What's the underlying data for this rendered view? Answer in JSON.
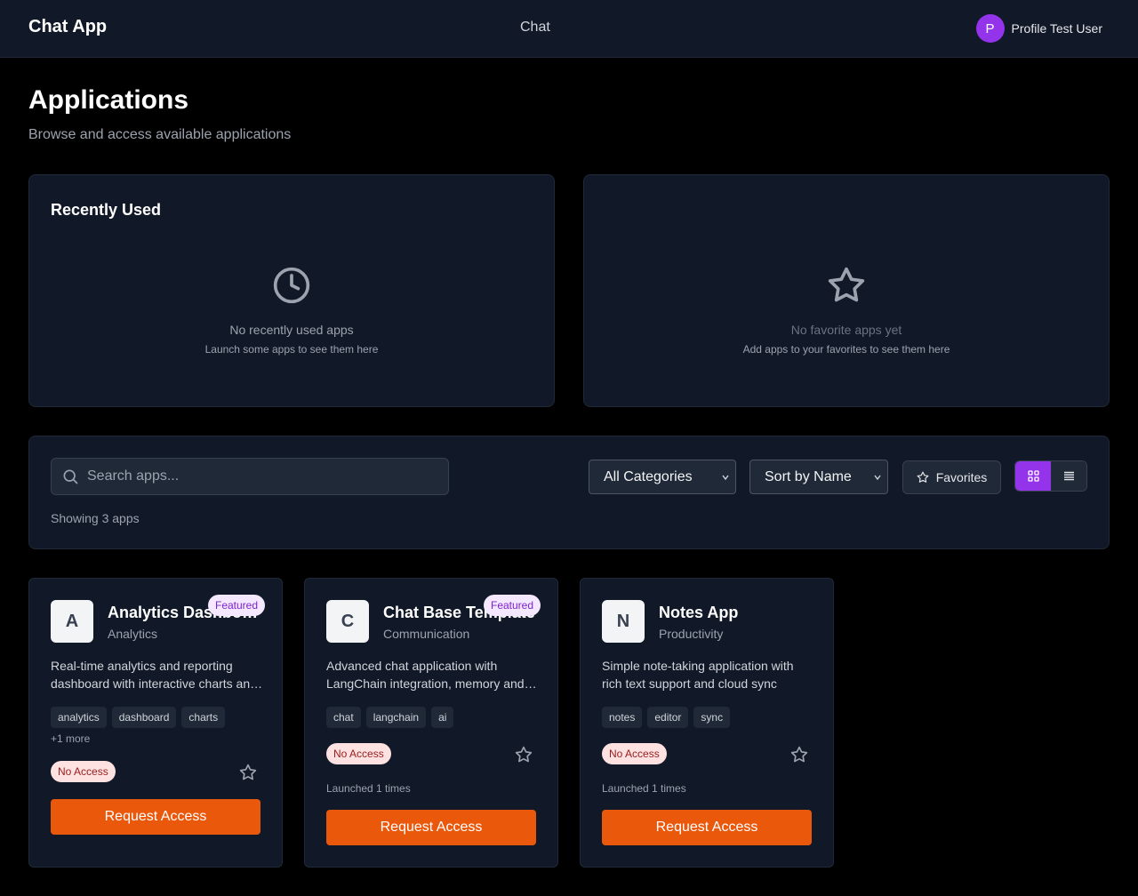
{
  "header": {
    "brand": "Chat App",
    "nav_chat": "Chat",
    "avatar_letter": "P",
    "username": "Profile Test User"
  },
  "page": {
    "title": "Applications",
    "subtitle": "Browse and access available applications"
  },
  "recent": {
    "title": "Recently Used",
    "empty_main": "No recently used apps",
    "empty_sub": "Launch some apps to see them here",
    "icon": "clock-icon"
  },
  "favorites": {
    "empty_main": "No favorite apps yet",
    "empty_sub": "Add apps to your favorites to see them here",
    "icon": "star-icon"
  },
  "filters": {
    "search_placeholder": "Search apps...",
    "category": "All Categories",
    "sort": "Sort by Name",
    "favorites_label": "Favorites",
    "view_modes": [
      "grid-view-icon",
      "list-view-icon"
    ],
    "active_view": "grid",
    "showing": "Showing 3 apps"
  },
  "apps": [
    {
      "letter": "A",
      "name": "Analytics Dashboard",
      "category": "Analytics",
      "featured": "Featured",
      "description": "Real-time analytics and reporting dashboard with interactive charts and metrics",
      "tags": [
        "analytics",
        "dashboard",
        "charts"
      ],
      "more": "+1 more",
      "access": "No Access",
      "launched": "",
      "action": "Request Access"
    },
    {
      "letter": "C",
      "name": "Chat Base Template",
      "category": "Communication",
      "featured": "Featured",
      "description": "Advanced chat application with LangChain integration, memory and tools",
      "tags": [
        "chat",
        "langchain",
        "ai"
      ],
      "more": "",
      "access": "No Access",
      "launched": "Launched 1 times",
      "action": "Request Access"
    },
    {
      "letter": "N",
      "name": "Notes App",
      "category": "Productivity",
      "featured": "",
      "description": "Simple note-taking application with rich text support and cloud sync",
      "tags": [
        "notes",
        "editor",
        "sync"
      ],
      "more": "",
      "access": "No Access",
      "launched": "Launched 1 times",
      "action": "Request Access"
    }
  ],
  "colors": {
    "accent": "#9333ea",
    "action": "#ea580c",
    "panel": "#111827",
    "featured_bg": "#f3e8ff"
  }
}
